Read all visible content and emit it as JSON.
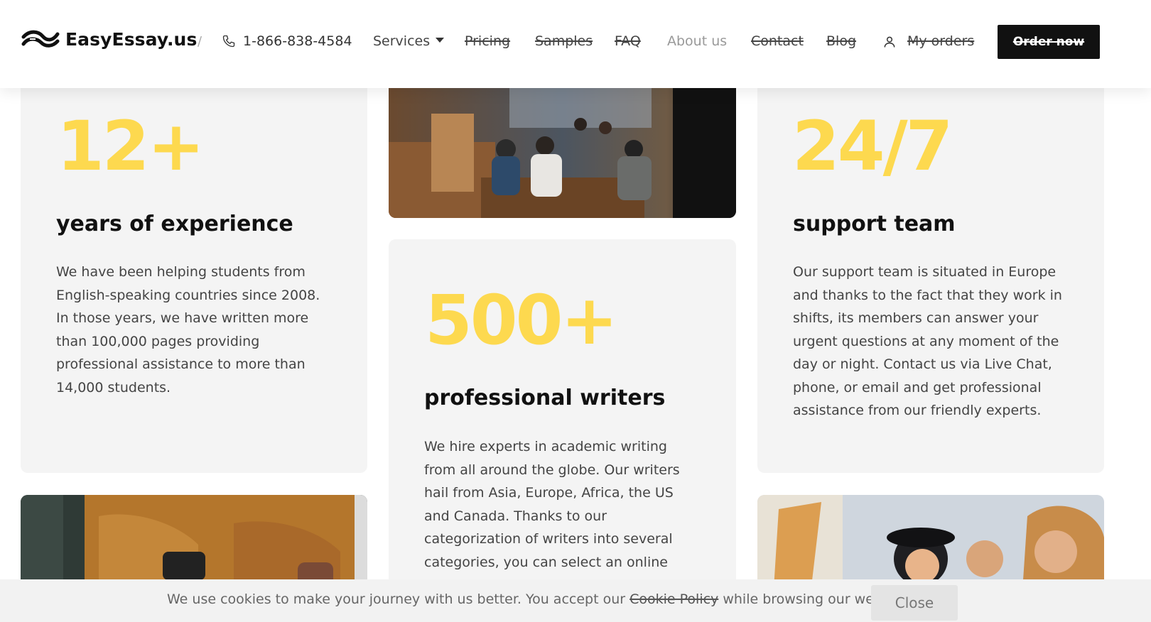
{
  "header": {
    "logo_text": "EasyEssay.us",
    "separator": "/",
    "phone": "1-866-838-4584",
    "nav": {
      "services": "Services",
      "pricing": "Pricing",
      "samples": "Samples",
      "faq": "FAQ",
      "about": "About us",
      "contact": "Contact",
      "blog": "Blog",
      "my_orders": "My orders"
    },
    "order_button": "Order now"
  },
  "cards": {
    "experience": {
      "number": "12+",
      "title": "years of experience",
      "text": "We have been helping students from English-speaking countries since 2008. In those years, we have written more than 100,000 pages providing professional assistance to more than 14,000 students."
    },
    "writers": {
      "number": "500+",
      "title": "professional writers",
      "text": "We hire experts in academic writing from all around the globe. Our writers hail from Asia, Europe, Africa, the US and Canada. Thanks to our categorization of writers into several categories, you can select an online helper who will perfectly suit the"
    },
    "support": {
      "number": "24/7",
      "title": "support team",
      "text": "Our support team is situated in Europe and thanks to the fact that they work in shifts, its members can answer your urgent questions at any moment of the day or night. Contact us via Live Chat, phone, or email and get professional assistance from our friendly experts."
    }
  },
  "cookie": {
    "text_before": "We use cookies to make your journey with us better. You accept our",
    "link": "Cookie Policy",
    "text_after": "while browsing our website.",
    "close": "Close"
  },
  "colors": {
    "accent_yellow": "#fdd94f",
    "card_bg": "#f4f4f4",
    "button_dark": "#111111"
  },
  "icons": [
    "logo-icon",
    "phone-icon",
    "caret-down-icon",
    "user-icon"
  ]
}
